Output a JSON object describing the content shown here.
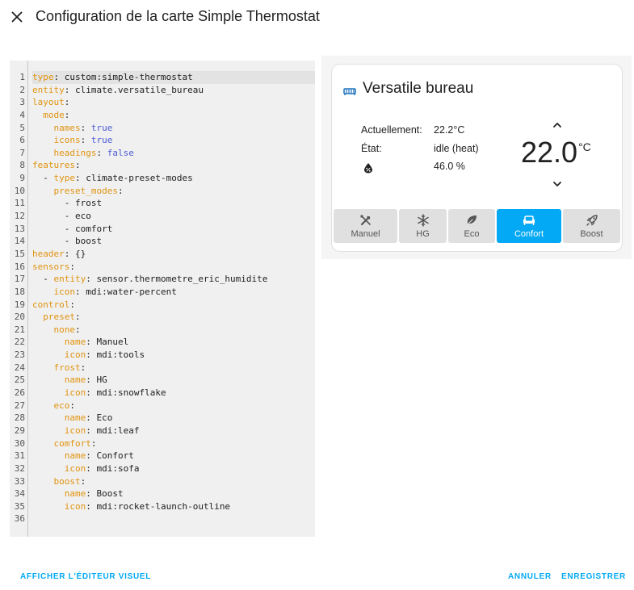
{
  "dialog": {
    "title": "Configuration de la carte Simple Thermostat",
    "close_icon": "close-icon"
  },
  "editor": {
    "active_line": 1,
    "lines": [
      [
        {
          "t": "type",
          "c": "k"
        },
        {
          "t": ": custom:simple-thermostat"
        }
      ],
      [
        {
          "t": "entity",
          "c": "k"
        },
        {
          "t": ": climate.versatile_bureau"
        }
      ],
      [
        {
          "t": "layout",
          "c": "k"
        },
        {
          "t": ":"
        }
      ],
      [
        {
          "t": "  "
        },
        {
          "t": "mode",
          "c": "k"
        },
        {
          "t": ":"
        }
      ],
      [
        {
          "t": "    "
        },
        {
          "t": "names",
          "c": "k"
        },
        {
          "t": ": "
        },
        {
          "t": "true",
          "c": "b"
        }
      ],
      [
        {
          "t": "    "
        },
        {
          "t": "icons",
          "c": "k"
        },
        {
          "t": ": "
        },
        {
          "t": "true",
          "c": "b"
        }
      ],
      [
        {
          "t": "    "
        },
        {
          "t": "headings",
          "c": "k"
        },
        {
          "t": ": "
        },
        {
          "t": "false",
          "c": "b"
        }
      ],
      [
        {
          "t": "features",
          "c": "k"
        },
        {
          "t": ":"
        }
      ],
      [
        {
          "t": "  - "
        },
        {
          "t": "type",
          "c": "k"
        },
        {
          "t": ": climate-preset-modes"
        }
      ],
      [
        {
          "t": "    "
        },
        {
          "t": "preset_modes",
          "c": "k"
        },
        {
          "t": ":"
        }
      ],
      [
        {
          "t": "      - frost"
        }
      ],
      [
        {
          "t": "      - eco"
        }
      ],
      [
        {
          "t": "      - comfort"
        }
      ],
      [
        {
          "t": "      - boost"
        }
      ],
      [
        {
          "t": "header",
          "c": "k"
        },
        {
          "t": ": {}"
        }
      ],
      [
        {
          "t": "sensors",
          "c": "k"
        },
        {
          "t": ":"
        }
      ],
      [
        {
          "t": "  - "
        },
        {
          "t": "entity",
          "c": "k"
        },
        {
          "t": ": sensor.thermometre_eric_humidite"
        }
      ],
      [
        {
          "t": "    "
        },
        {
          "t": "icon",
          "c": "k"
        },
        {
          "t": ": mdi:water-percent"
        }
      ],
      [
        {
          "t": "control",
          "c": "k"
        },
        {
          "t": ":"
        }
      ],
      [
        {
          "t": "  "
        },
        {
          "t": "preset",
          "c": "k"
        },
        {
          "t": ":"
        }
      ],
      [
        {
          "t": "    "
        },
        {
          "t": "none",
          "c": "k"
        },
        {
          "t": ":"
        }
      ],
      [
        {
          "t": "      "
        },
        {
          "t": "name",
          "c": "k"
        },
        {
          "t": ": Manuel"
        }
      ],
      [
        {
          "t": "      "
        },
        {
          "t": "icon",
          "c": "k"
        },
        {
          "t": ": mdi:tools"
        }
      ],
      [
        {
          "t": "    "
        },
        {
          "t": "frost",
          "c": "k"
        },
        {
          "t": ":"
        }
      ],
      [
        {
          "t": "      "
        },
        {
          "t": "name",
          "c": "k"
        },
        {
          "t": ": HG"
        }
      ],
      [
        {
          "t": "      "
        },
        {
          "t": "icon",
          "c": "k"
        },
        {
          "t": ": mdi:snowflake"
        }
      ],
      [
        {
          "t": "    "
        },
        {
          "t": "eco",
          "c": "k"
        },
        {
          "t": ":"
        }
      ],
      [
        {
          "t": "      "
        },
        {
          "t": "name",
          "c": "k"
        },
        {
          "t": ": Eco"
        }
      ],
      [
        {
          "t": "      "
        },
        {
          "t": "icon",
          "c": "k"
        },
        {
          "t": ": mdi:leaf"
        }
      ],
      [
        {
          "t": "    "
        },
        {
          "t": "comfort",
          "c": "k"
        },
        {
          "t": ":"
        }
      ],
      [
        {
          "t": "      "
        },
        {
          "t": "name",
          "c": "k"
        },
        {
          "t": ": Confort"
        }
      ],
      [
        {
          "t": "      "
        },
        {
          "t": "icon",
          "c": "k"
        },
        {
          "t": ": mdi:sofa"
        }
      ],
      [
        {
          "t": "    "
        },
        {
          "t": "boost",
          "c": "k"
        },
        {
          "t": ":"
        }
      ],
      [
        {
          "t": "      "
        },
        {
          "t": "name",
          "c": "k"
        },
        {
          "t": ": Boost"
        }
      ],
      [
        {
          "t": "      "
        },
        {
          "t": "icon",
          "c": "k"
        },
        {
          "t": ": mdi:rocket-launch-outline"
        }
      ],
      []
    ]
  },
  "card": {
    "title": "Versatile bureau",
    "title_icon": "radiator-icon",
    "current_label": "Actuellement:",
    "current_value": "22.2°C",
    "state_label": "État:",
    "state_value": "idle (heat)",
    "humidity_icon": "water-percent-icon",
    "humidity_value": "46.0 %",
    "target_temp": "22.0",
    "target_unit": "°C",
    "increase_icon": "chevron-up-icon",
    "decrease_icon": "chevron-down-icon",
    "presets": [
      {
        "label": "Manuel",
        "icon": "tools-icon",
        "active": false
      },
      {
        "label": "HG",
        "icon": "snowflake-icon",
        "active": false
      },
      {
        "label": "Eco",
        "icon": "leaf-icon",
        "active": false
      },
      {
        "label": "Confort",
        "icon": "sofa-icon",
        "active": true
      },
      {
        "label": "Boost",
        "icon": "rocket-launch-outline-icon",
        "active": false
      }
    ]
  },
  "footer": {
    "visual_editor_label": "AFFICHER L'ÉDITEUR VISUEL",
    "cancel_label": "ANNULER",
    "save_label": "ENREGISTRER"
  },
  "colors": {
    "accent": "#03a9f4",
    "yaml_key": "#e0930f",
    "yaml_bool": "#4a5ad6"
  }
}
